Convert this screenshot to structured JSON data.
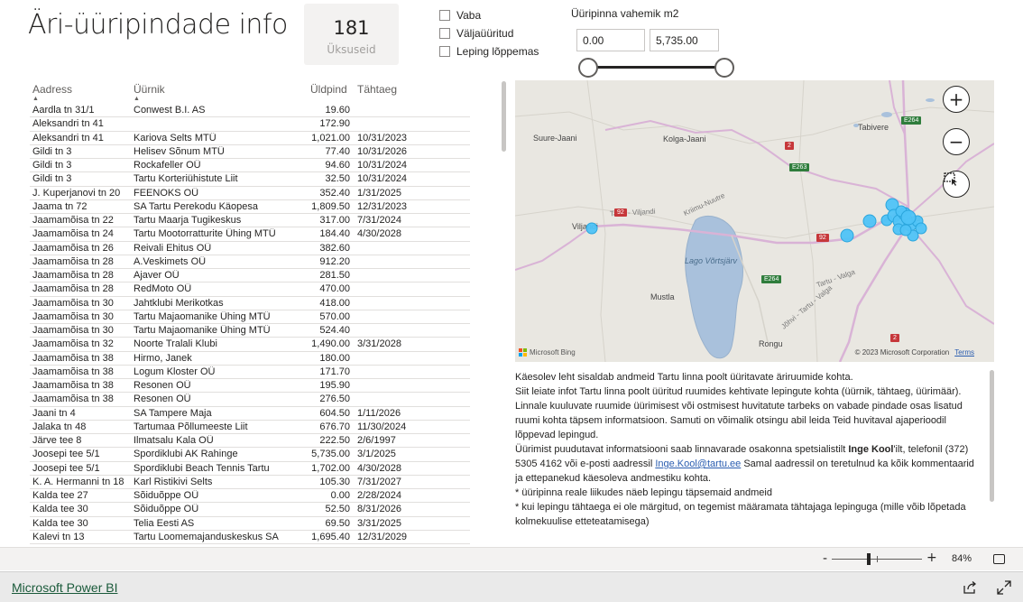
{
  "header": {
    "title": "Äri-üüripindade info"
  },
  "kpi": {
    "value": "181",
    "label": "Üksuseid"
  },
  "filters": [
    {
      "label": "Vaba",
      "checked": false
    },
    {
      "label": "Väljaüüritud",
      "checked": false
    },
    {
      "label": "Leping lõppemas",
      "checked": false
    }
  ],
  "range": {
    "title": "Üüripinna vahemik m2",
    "min_value": "0.00",
    "max_value": "5,735.00",
    "slider_low": 0.0,
    "slider_high": 5735.0
  },
  "table": {
    "columns": [
      "Aadress",
      "Üürnik",
      "Üldpind",
      "Tähtaeg"
    ],
    "rows": [
      [
        "Aardla tn 31/1",
        "Conwest B.I. AS",
        "19.60",
        ""
      ],
      [
        "Aleksandri tn 41",
        "",
        "172.90",
        ""
      ],
      [
        "Aleksandri tn 41",
        "Kariova Selts MTÜ",
        "1,021.00",
        "10/31/2023"
      ],
      [
        "Gildi tn 3",
        "Helisev Sõnum MTÜ",
        "77.40",
        "10/31/2026"
      ],
      [
        "Gildi tn 3",
        "Rockafeller OÜ",
        "94.60",
        "10/31/2024"
      ],
      [
        "Gildi tn 3",
        "Tartu Korteriühistute Liit",
        "32.50",
        "10/31/2024"
      ],
      [
        "J. Kuperjanovi tn 20",
        "FEENOKS OÜ",
        "352.40",
        "1/31/2025"
      ],
      [
        "Jaama tn 72",
        "SA Tartu Perekodu Käopesa",
        "1,809.50",
        "12/31/2023"
      ],
      [
        "Jaamamõisa tn 22",
        "Tartu Maarja Tugikeskus",
        "317.00",
        "7/31/2024"
      ],
      [
        "Jaamamõisa tn 24",
        "Tartu Mootorratturite Ühing MTÜ",
        "184.40",
        "4/30/2028"
      ],
      [
        "Jaamamõisa tn 26",
        "Reivali Ehitus OÜ",
        "382.60",
        ""
      ],
      [
        "Jaamamõisa tn 28",
        "A.Veskimets OÜ",
        "912.20",
        ""
      ],
      [
        "Jaamamõisa tn 28",
        "Ajaver OÜ",
        "281.50",
        ""
      ],
      [
        "Jaamamõisa tn 28",
        "RedMoto OÜ",
        "470.00",
        ""
      ],
      [
        "Jaamamõisa tn 30",
        "Jahtklubi Merikotkas",
        "418.00",
        ""
      ],
      [
        "Jaamamõisa tn 30",
        "Tartu Majaomanike Ühing MTÜ",
        "570.00",
        ""
      ],
      [
        "Jaamamõisa tn 30",
        "Tartu Majaomanike Ühing MTÜ",
        "524.40",
        ""
      ],
      [
        "Jaamamõisa tn 32",
        "Noorte Tralali Klubi",
        "1,490.00",
        "3/31/2028"
      ],
      [
        "Jaamamõisa tn 38",
        "Hirmo, Janek",
        "180.00",
        ""
      ],
      [
        "Jaamamõisa tn 38",
        "Logum Kloster OÜ",
        "171.70",
        ""
      ],
      [
        "Jaamamõisa tn 38",
        "Resonen OÜ",
        "195.90",
        ""
      ],
      [
        "Jaamamõisa tn 38",
        "Resonen OÜ",
        "276.50",
        ""
      ],
      [
        "Jaani tn 4",
        "SA Tampere Maja",
        "604.50",
        "1/11/2026"
      ],
      [
        "Jalaka tn 48",
        "Tartumaa Põllumeeste Liit",
        "676.70",
        "11/30/2024"
      ],
      [
        "Järve tee 8",
        "Ilmatsalu Kala OÜ",
        "222.50",
        "2/6/1997"
      ],
      [
        "Joosepi tee 5/1",
        "Spordiklubi AK Rahinge",
        "5,735.00",
        "3/1/2025"
      ],
      [
        "Joosepi tee 5/1",
        "Spordiklubi Beach Tennis Tartu",
        "1,702.00",
        "4/30/2028"
      ],
      [
        "K. A. Hermanni tn 18",
        "Karl Ristikivi Selts",
        "105.30",
        "7/31/2027"
      ],
      [
        "Kalda tee 27",
        "Sõiduõppe OÜ",
        "0.00",
        "2/28/2024"
      ],
      [
        "Kalda tee 30",
        "Sõiduõppe OÜ",
        "52.50",
        "8/31/2026"
      ],
      [
        "Kalda tee 30",
        "Telia Eesti AS",
        "69.50",
        "3/31/2025"
      ],
      [
        "Kalevi tn 13",
        "Tartu Loomemajanduskeskus SA",
        "1,695.40",
        "12/31/2029"
      ]
    ]
  },
  "map": {
    "places": [
      {
        "name": "Tabivere"
      },
      {
        "name": "Suure-Jaani"
      },
      {
        "name": "Kolga-Jaani"
      },
      {
        "name": "Viljandi"
      },
      {
        "name": "Lago Võrtsjärv"
      },
      {
        "name": "Mustla"
      },
      {
        "name": "Rongu"
      },
      {
        "name": "Tartu - Viljandi"
      },
      {
        "name": "Kriimu-Nuutre"
      },
      {
        "name": "Tartu - Valga"
      },
      {
        "name": "Jõhvi - Tartu - Valga"
      },
      {
        "name": "Tartu"
      }
    ],
    "shields": [
      "E264",
      "2",
      "E263",
      "92",
      "92",
      "E264",
      "2"
    ],
    "brand": "Microsoft Bing",
    "copyright": "© 2023 Microsoft Corporation",
    "terms": "Terms",
    "buttons": {
      "zoom_in": "zoom-in",
      "zoom_out": "zoom-out",
      "select": "selection-tool"
    },
    "accent": "#4fc3f7"
  },
  "info": {
    "p1": "Käesolev leht sisaldab andmeid Tartu linna poolt üüritavate äriruumide kohta.",
    "p2": "Siit leiate infot Tartu linna poolt üüritud ruumides kehtivate lepingute kohta (üürnik, tähtaeg, üürimäär). Linnale kuuluvate ruumide üürimisest või ostmisest huvitatute tarbeks on vabade pindade osas lisatud ruumi kohta täpsem informatsioon. Samuti on võimalik otsingu abil leida Teid huvitaval ajaperioodil lõppevad lepingud.",
    "p3_pre": "Üürimist puudutavat informatsiooni saab linnavarade osakonna spetsialistilt",
    "p3_name": "Inge Kool",
    "p3_mid": "'ilt, telefonil (372) 5305 4162 või e-posti aadressil",
    "p3_email": "Inge.Kool@tartu.ee",
    "p3_post": "Samal aadressil on teretulnud ka kõik kommentaarid ja ettepanekud käesoleva andmestiku kohta.",
    "p4": "* üüripinna reale liikudes näeb lepingu täpsemaid andmeid",
    "p5": "* kui lepingu tähtaega ei ole märgitud, on tegemist määramata tähtajaga lepinguga (mille võib lõpetada kolmekuulise etteteatamisega)"
  },
  "zoom": {
    "value": "84%",
    "level": 0.84
  },
  "footer": {
    "brand": "Microsoft Power BI",
    "share_icon": "share-icon",
    "expand_icon": "expand-icon"
  }
}
